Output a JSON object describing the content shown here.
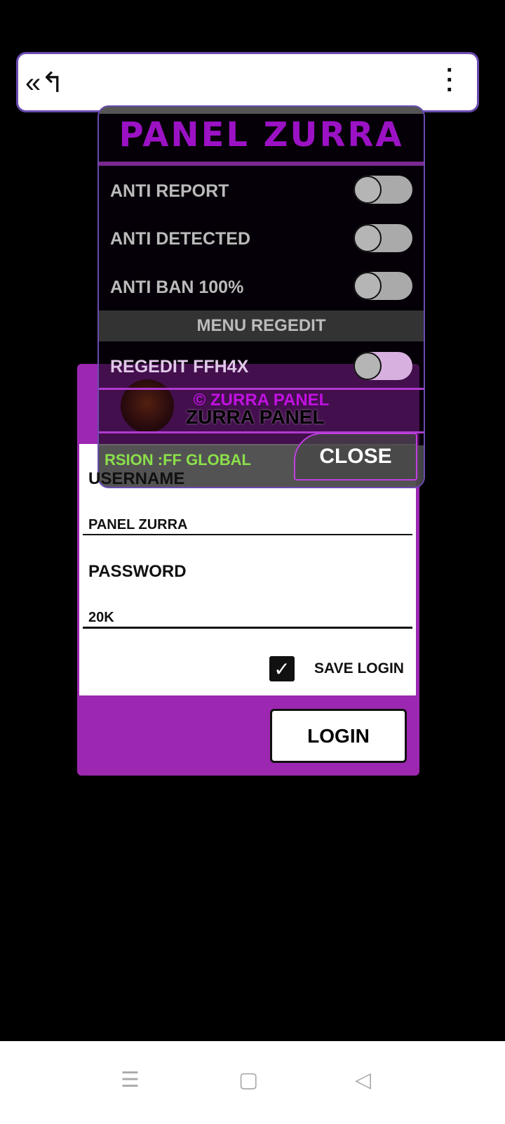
{
  "login": {
    "title": "ZURRA PANEL",
    "username_label": "USERNAME",
    "username_value": "PANEL ZURRA",
    "password_label": "PASSWORD",
    "password_value": "20K",
    "save_login": "SAVE LOGIN",
    "save_login_checked": true,
    "login_button": "LOGIN"
  },
  "overlay": {
    "title": "PANEL ZURRA",
    "toggles": [
      {
        "label": "ANTI REPORT",
        "on": false
      },
      {
        "label": "ANTI DETECTED",
        "on": false
      },
      {
        "label": "ANTI BAN 100%",
        "on": false
      }
    ],
    "section": "MENU REGEDIT",
    "regedit": {
      "label": "REGEDIT FFH4X",
      "on": false
    },
    "copyright": "© ZURRA PANEL",
    "version": "RSION :FF GLOBAL",
    "close": "CLOSE"
  },
  "colors": {
    "accent": "#9c27b0",
    "title": "#9b12c4",
    "version": "#8be04a"
  }
}
